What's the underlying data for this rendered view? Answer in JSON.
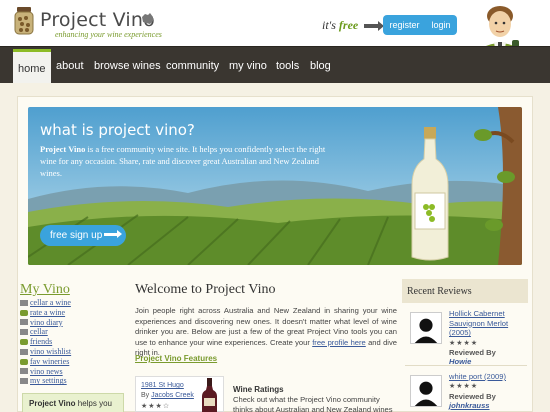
{
  "header": {
    "logo_title": "Project Vino",
    "tagline": "enhancing your wine experiences",
    "its": "it's",
    "free": "free",
    "register_label": "register",
    "login_label": "login"
  },
  "nav": {
    "items": [
      "home",
      "about",
      "browse wines",
      "community",
      "my vino",
      "tools",
      "blog"
    ],
    "active": "home"
  },
  "hero": {
    "title": "what is project vino?",
    "text_brand": "Project Vino",
    "text_body": " is a free community wine site. It helps you confidently select the right wine for any occasion. Share, rate and discover great Australian and New Zealand wines.",
    "signup_label": "free sign up"
  },
  "sidebar": {
    "title": "My Vino",
    "links": [
      "cellar a wine",
      "rate a wine",
      "vino diary",
      "cellar",
      "friends",
      "vino wishlist",
      "fav wineries",
      "vino news",
      "my settings"
    ],
    "promo_brand": "Project Vino",
    "promo_text": " helps you"
  },
  "main": {
    "welcome": "Welcome to Project Vino",
    "intro_text": "Join people right across Australia and New Zealand in sharing your wine experiences and discovering new ones. It doesn't matter what level of wine drinker you are. Below are just a few of the great Project Vino tools you can use to enhance your wine experiences. Create your ",
    "intro_link": "free profile here",
    "intro_tail": " and dive right in.",
    "features_title": "Project Vino Features",
    "wine_card": {
      "name": "1981 St Hugo",
      "by_label": "By",
      "by_link": "Jacobs Creek",
      "stars": "★★★☆"
    },
    "ratings_title": "Wine Ratings",
    "ratings_text": "Check out what the Project Vino community thinks about Australian and New Zealand wines"
  },
  "reviews": {
    "title": "Recent Reviews",
    "items": [
      {
        "wine": "Hollick Cabernet Sauvignon Merlot (2005)",
        "stars": "★★★★",
        "reviewed_by": "Reviewed By",
        "user": "Howie"
      },
      {
        "wine": "white port (2009)",
        "stars": "★★★★",
        "reviewed_by": "Reviewed By",
        "user": "johnkrauss"
      }
    ]
  },
  "colors": {
    "nav_bg": "#3a3630",
    "accent_green": "#8cbb26",
    "accent_blue": "#3aa3dd",
    "link_blue": "#3a5a9a",
    "panel_bg": "#f5f1e4"
  }
}
